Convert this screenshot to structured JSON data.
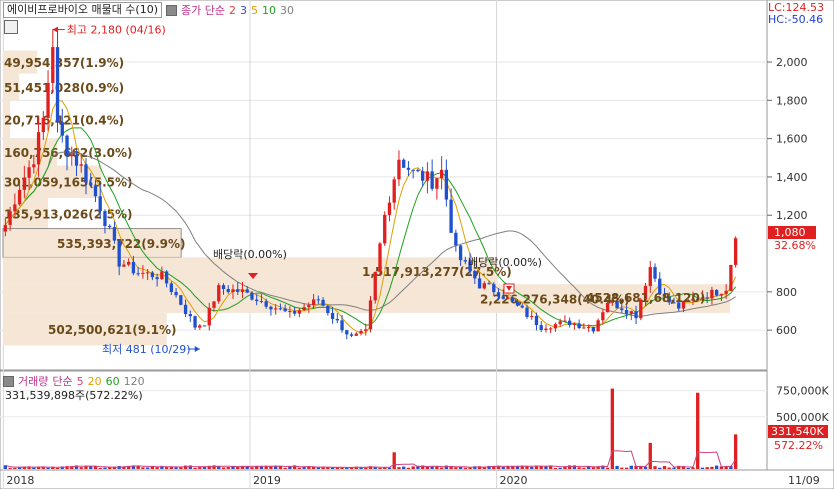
{
  "header": {
    "title": "에이비프로바이오 매물대 수(10)",
    "ma_label": "종가 단순",
    "ma_periods": [
      "2",
      "3",
      "5",
      "10",
      "30"
    ],
    "ma_colors": [
      "#e04040",
      "#3050d0",
      "#e0a000",
      "#20a020",
      "#808080"
    ],
    "lc": "LC:124.53",
    "hc": "HC:-50.46"
  },
  "price_axis": [
    "2,000",
    "1,800",
    "1,600",
    "1,400",
    "1,200",
    "800",
    "600"
  ],
  "price_axis_values": [
    2000,
    1800,
    1600,
    1400,
    1200,
    800,
    600
  ],
  "current_price": {
    "value": "1,080",
    "change": "32.68%"
  },
  "annotations": {
    "high": "최고 2,180 (04/16)",
    "low": "최저 481 (10/29)",
    "dividend1": "배당락(0.00%)",
    "dividend2": "배당락(0.00%)"
  },
  "volume_profile": [
    {
      "price_low": 1940,
      "price_high": 2060,
      "label": "49,954,357(1.9%)",
      "share": 1.9
    },
    {
      "price_low": 1800,
      "price_high": 1940,
      "label": "51,451,028(0.9%)",
      "share": 0.9
    },
    {
      "price_low": 1600,
      "price_high": 1800,
      "label": "20,716,421(0.4%)",
      "share": 0.4
    },
    {
      "price_low": 1460,
      "price_high": 1600,
      "label": "160,756,662(3.0%)",
      "share": 3.0
    },
    {
      "price_low": 1290,
      "price_high": 1460,
      "label": "301,059,165(5.5%)",
      "share": 5.5
    },
    {
      "price_low": 1130,
      "price_high": 1290,
      "label": "135,913,026(2.5%)",
      "share": 2.5
    },
    {
      "price_low": 980,
      "price_high": 1130,
      "label": "535,393,722(9.9%)",
      "share": 9.9
    },
    {
      "price_low": 840,
      "price_high": 980,
      "label": "1,517,913,277(27.5%)",
      "share": 27.5
    },
    {
      "price_low": 690,
      "price_high": 840,
      "label": "2,226,276,348(40.4%)",
      "share": 40.4
    },
    {
      "price_low": 520,
      "price_high": 690,
      "label": "502,500,621(9.1%)",
      "share": 9.1
    }
  ],
  "volume_profile_extra_label": "4528,681,68,120)",
  "volume_header": {
    "title": "거래량",
    "ma_label": "단순",
    "periods": [
      "5",
      "20",
      "60",
      "120"
    ],
    "colors": [
      "#d04080",
      "#e0a000",
      "#20a020",
      "#808080"
    ],
    "value_text": "331,539,898주(572.22%)"
  },
  "volume_axis": [
    "750,000K",
    "500,000K"
  ],
  "volume_axis_values": [
    750000,
    500000
  ],
  "volume_current": {
    "value": "331,540K",
    "change": "572.22%"
  },
  "x_axis": [
    "2018",
    "2019",
    "2020",
    "11/09"
  ],
  "chart_data": {
    "type": "candlestick",
    "title": "에이비프로바이오 매물대 수(10)",
    "ylim": [
      470,
      2230
    ],
    "volume_ylim_k": [
      0,
      900000
    ],
    "x_labels": [
      "2018",
      "2019",
      "2020",
      "11/09"
    ],
    "close_keypoints": [
      {
        "week": 0,
        "price": 1150
      },
      {
        "week": 3,
        "price": 1350
      },
      {
        "week": 6,
        "price": 1500
      },
      {
        "week": 8,
        "price": 1700
      },
      {
        "week": 10,
        "price": 2100
      },
      {
        "week": 11,
        "price": 1650
      },
      {
        "week": 13,
        "price": 1550
      },
      {
        "week": 16,
        "price": 1450
      },
      {
        "week": 20,
        "price": 1250
      },
      {
        "week": 24,
        "price": 960
      },
      {
        "week": 28,
        "price": 900
      },
      {
        "week": 33,
        "price": 880
      },
      {
        "week": 36,
        "price": 780
      },
      {
        "week": 40,
        "price": 620
      },
      {
        "week": 42,
        "price": 640
      },
      {
        "week": 45,
        "price": 820
      },
      {
        "week": 50,
        "price": 800
      },
      {
        "week": 56,
        "price": 730
      },
      {
        "week": 60,
        "price": 680
      },
      {
        "week": 66,
        "price": 760
      },
      {
        "week": 70,
        "price": 640
      },
      {
        "week": 73,
        "price": 560
      },
      {
        "week": 76,
        "price": 590
      },
      {
        "week": 80,
        "price": 1200
      },
      {
        "week": 83,
        "price": 1500
      },
      {
        "week": 86,
        "price": 1420
      },
      {
        "week": 90,
        "price": 1380
      },
      {
        "week": 92,
        "price": 1430
      },
      {
        "week": 95,
        "price": 1000
      },
      {
        "week": 100,
        "price": 840
      },
      {
        "week": 104,
        "price": 800
      },
      {
        "week": 109,
        "price": 700
      },
      {
        "week": 113,
        "price": 620
      },
      {
        "week": 119,
        "price": 640
      },
      {
        "week": 124,
        "price": 610
      },
      {
        "week": 127,
        "price": 750
      },
      {
        "week": 130,
        "price": 720
      },
      {
        "week": 133,
        "price": 680
      },
      {
        "week": 136,
        "price": 930
      },
      {
        "week": 139,
        "price": 760
      },
      {
        "week": 142,
        "price": 720
      },
      {
        "week": 146,
        "price": 770
      },
      {
        "week": 150,
        "price": 800
      },
      {
        "week": 152,
        "price": 820
      },
      {
        "week": 154,
        "price": 1080
      }
    ],
    "volume_spikes_k": [
      {
        "week": 82,
        "value": 160000
      },
      {
        "week": 128,
        "value": 770000
      },
      {
        "week": 136,
        "value": 250000
      },
      {
        "week": 146,
        "value": 730000
      },
      {
        "week": 154,
        "value": 331540
      }
    ]
  }
}
